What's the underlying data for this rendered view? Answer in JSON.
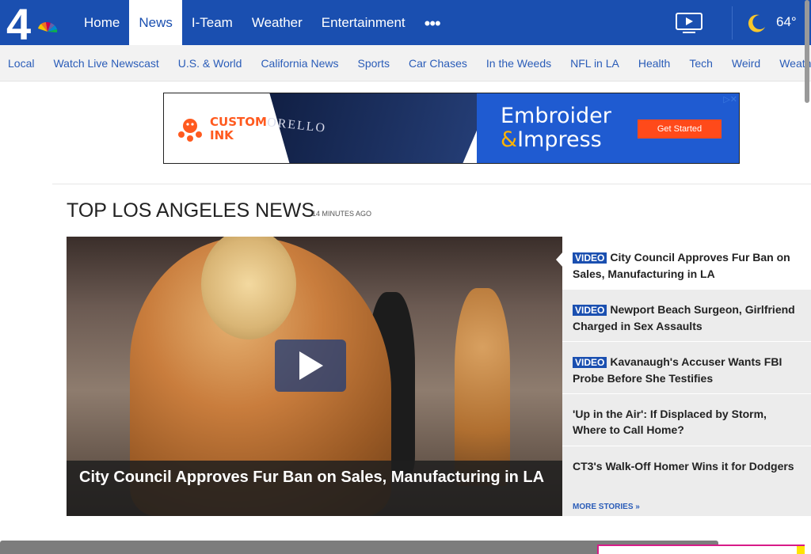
{
  "brand": {
    "logo_text": "4"
  },
  "nav": {
    "items": [
      {
        "label": "Home",
        "active": false
      },
      {
        "label": "News",
        "active": true
      },
      {
        "label": "I-Team",
        "active": false
      },
      {
        "label": "Weather",
        "active": false
      },
      {
        "label": "Entertainment",
        "active": false
      }
    ],
    "more_label": "•••"
  },
  "weather": {
    "temp": "64°"
  },
  "subnav": {
    "items": [
      "Local",
      "Watch Live Newscast",
      "U.S. & World",
      "California News",
      "Sports",
      "Car Chases",
      "In the Weeds",
      "NFL in LA",
      "Health",
      "Tech",
      "Weird",
      "Weather"
    ]
  },
  "ad": {
    "brand_line1": "CUSTOM",
    "brand_line2": "INK",
    "photo_text": "ORELLO",
    "headline_line1": "Embroider",
    "headline_amp": "&",
    "headline_line2": "Impress",
    "cta": "Get Started",
    "close": "▷✕"
  },
  "section": {
    "title": "TOP LOS ANGELES NEWS",
    "timestamp": "14 MINUTES AGO"
  },
  "hero": {
    "caption": "City Council Approves Fur Ban on Sales, Manufacturing in LA"
  },
  "stories": [
    {
      "badge": "VIDEO",
      "title": "City Council Approves Fur Ban on Sales, Manufacturing in LA"
    },
    {
      "badge": "VIDEO",
      "title": "Newport Beach Surgeon, Girlfriend Charged in Sex Assaults"
    },
    {
      "badge": "VIDEO",
      "title": "Kavanaugh's Accuser Wants FBI Probe Before She Testifies"
    },
    {
      "badge": "",
      "title": "'Up in the Air': If Displaced by Storm, Where to Call Home?"
    },
    {
      "badge": "",
      "title": "CT3's Walk-Off Homer Wins it for Dodgers"
    }
  ],
  "more_stories": "MORE STORIES »",
  "colors": {
    "brand_blue": "#1a4fb0",
    "link_blue": "#2a5cb8",
    "ad_orange": "#ff5a1f"
  }
}
